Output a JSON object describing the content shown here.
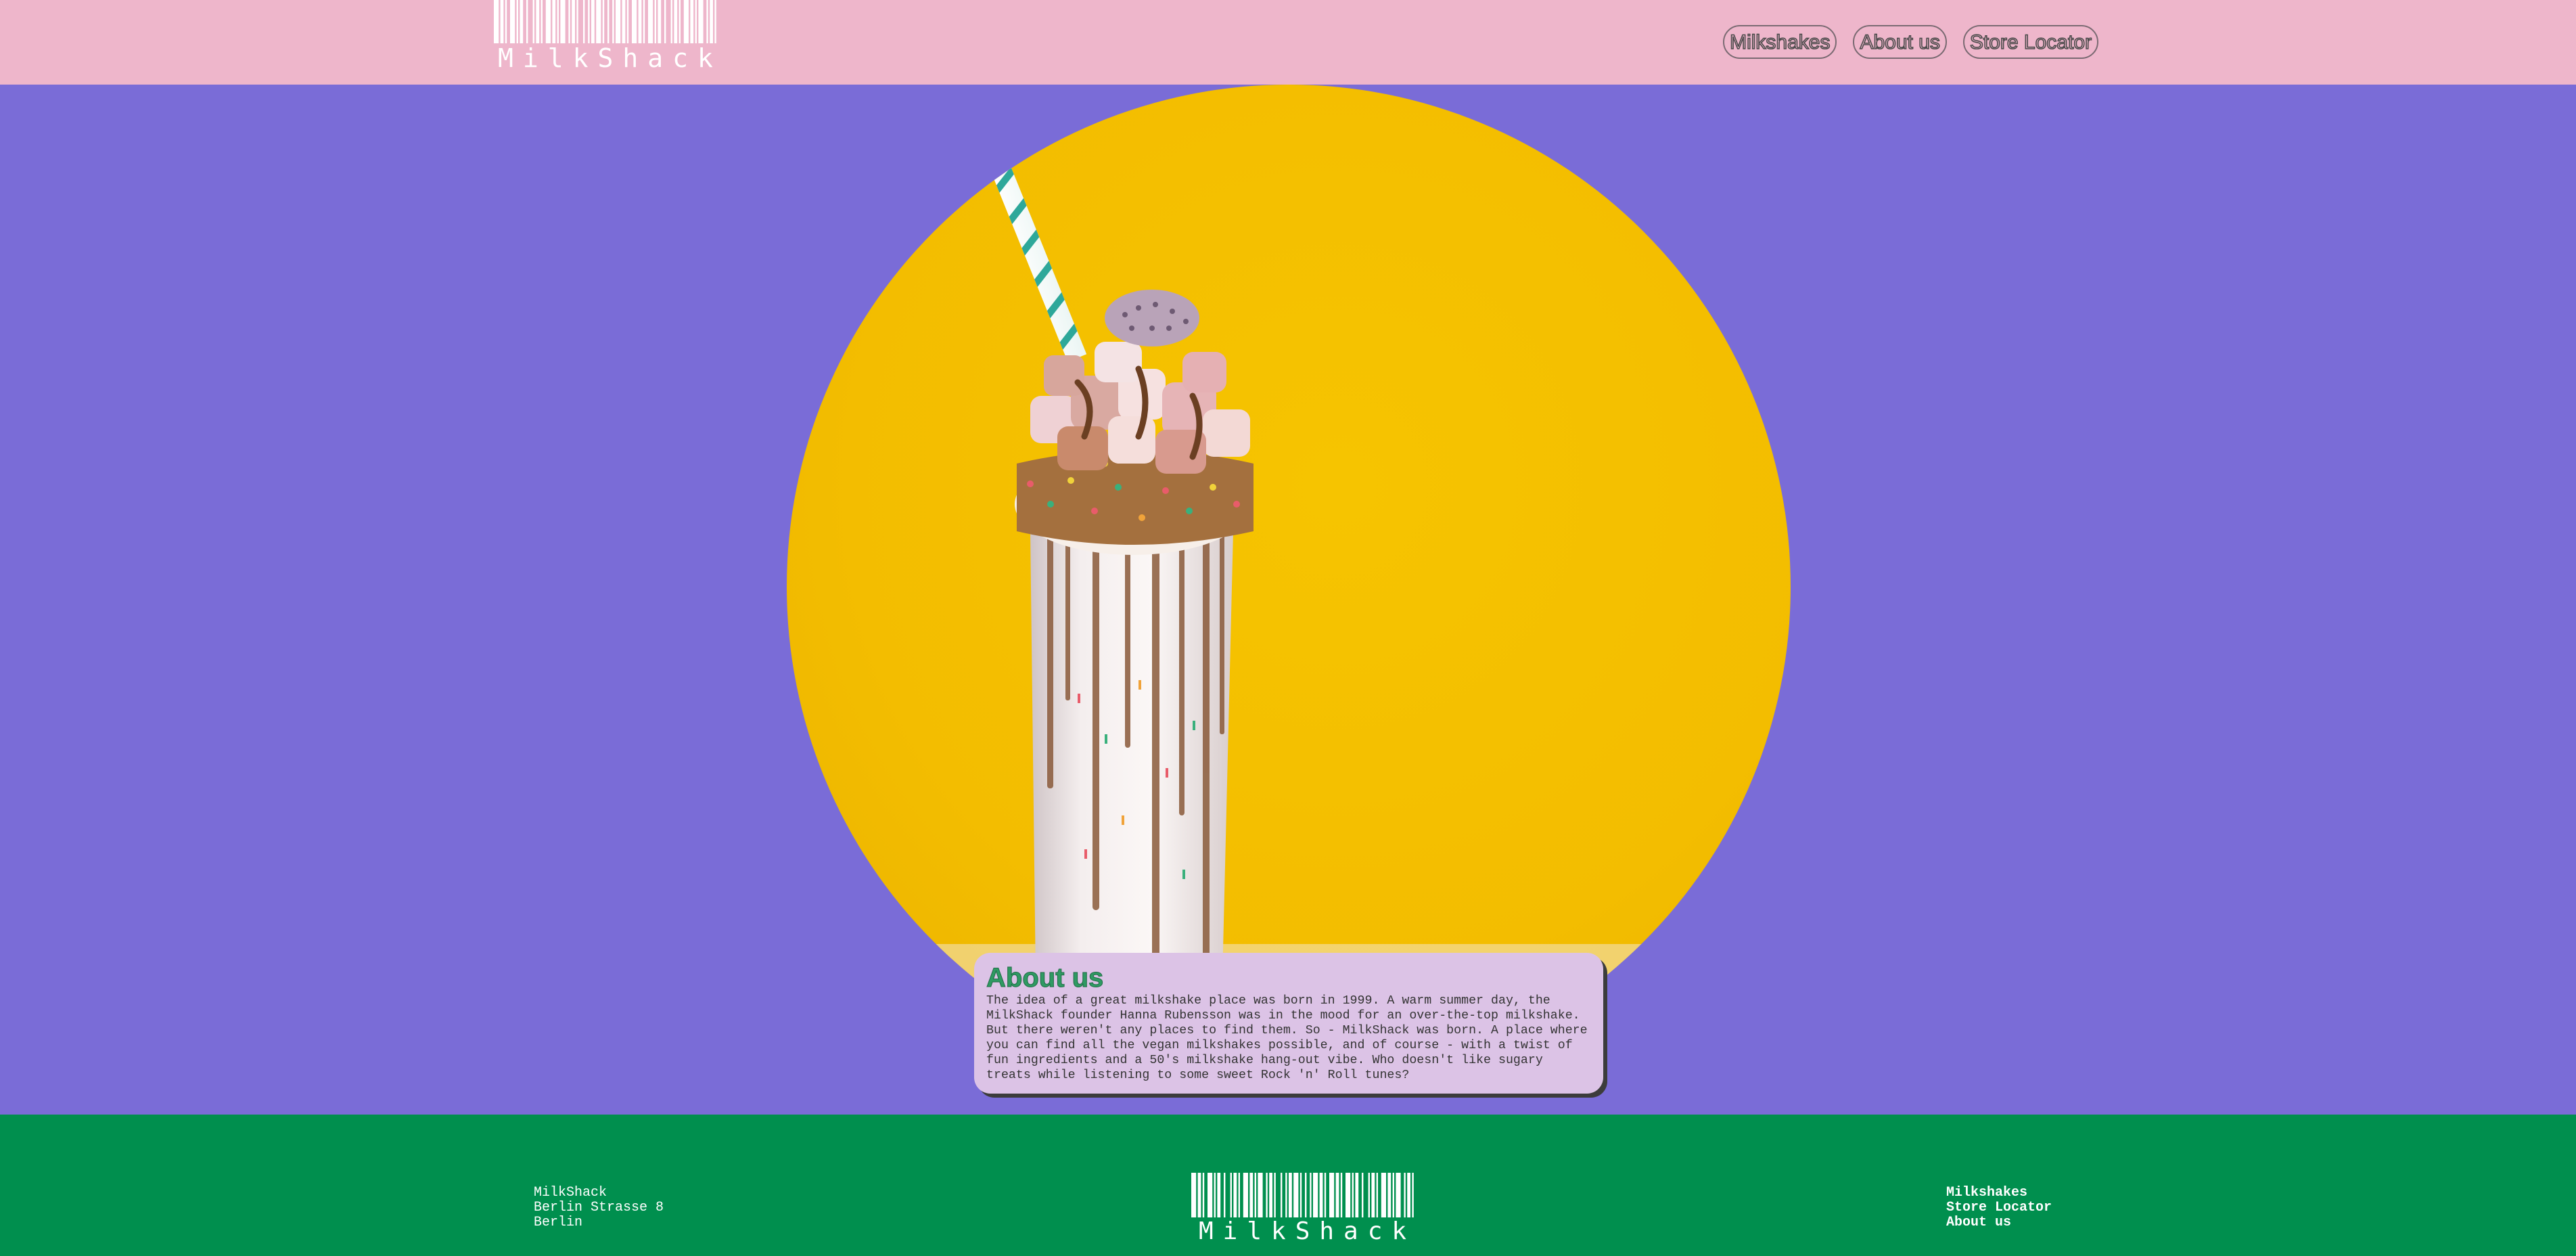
{
  "header": {
    "logo_text": "MilkShack",
    "nav": [
      {
        "label": "Milkshakes"
      },
      {
        "label": "About us"
      },
      {
        "label": "Store Locator"
      }
    ]
  },
  "hero": {
    "image_alt": "Freakshake milkshake with marshmallows, sprinkles and chocolate drizzle on yellow background"
  },
  "about": {
    "title": "About us",
    "body": "The idea of a great milkshake place was born in 1999. A warm summer day, the MilkShack founder Hanna Rubensson was in the mood for an over-the-top milkshake. But there weren't any places to find them. So - MilkShack was born. A place where you can find all the vegan milkshakes possible, and of course - with a twist of fun ingredients and a 50's milkshake hang-out vibe. Who doesn't like sugary treats while listening to some sweet Rock 'n' Roll tunes?"
  },
  "footer": {
    "address": [
      "MilkShack",
      "Berlin Strasse 8",
      "Berlin"
    ],
    "logo_text": "MilkShack",
    "links": [
      {
        "label": "Milkshakes"
      },
      {
        "label": "Store Locator"
      },
      {
        "label": "About us"
      }
    ]
  },
  "colors": {
    "header_bg": "#eeb6cb",
    "page_bg": "#7a6cd7",
    "circle_bg": "#f6c400",
    "card_bg": "#dcc3e6",
    "title_green": "#2f9a63",
    "footer_bg": "#008f4e"
  },
  "icons": {
    "logo_barcode": "barcode-icon"
  }
}
